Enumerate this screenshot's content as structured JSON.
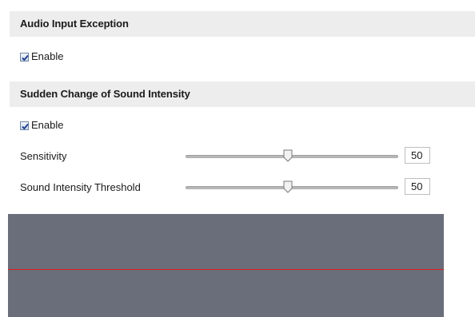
{
  "audio_input_exception": {
    "title": "Audio Input Exception",
    "enable_label": "Enable",
    "enabled": true
  },
  "sudden_change": {
    "title": "Sudden Change of Sound Intensity",
    "enable_label": "Enable",
    "enabled": true,
    "sensitivity": {
      "label": "Sensitivity",
      "value": "50",
      "level_percent": 50
    },
    "threshold": {
      "label": "Sound Intensity Threshold",
      "value": "50",
      "level_percent": 50
    }
  },
  "colors": {
    "header_bg": "#ededed",
    "canvas_bg": "#6a6e7a",
    "threshold_line": "#e11b1b"
  }
}
